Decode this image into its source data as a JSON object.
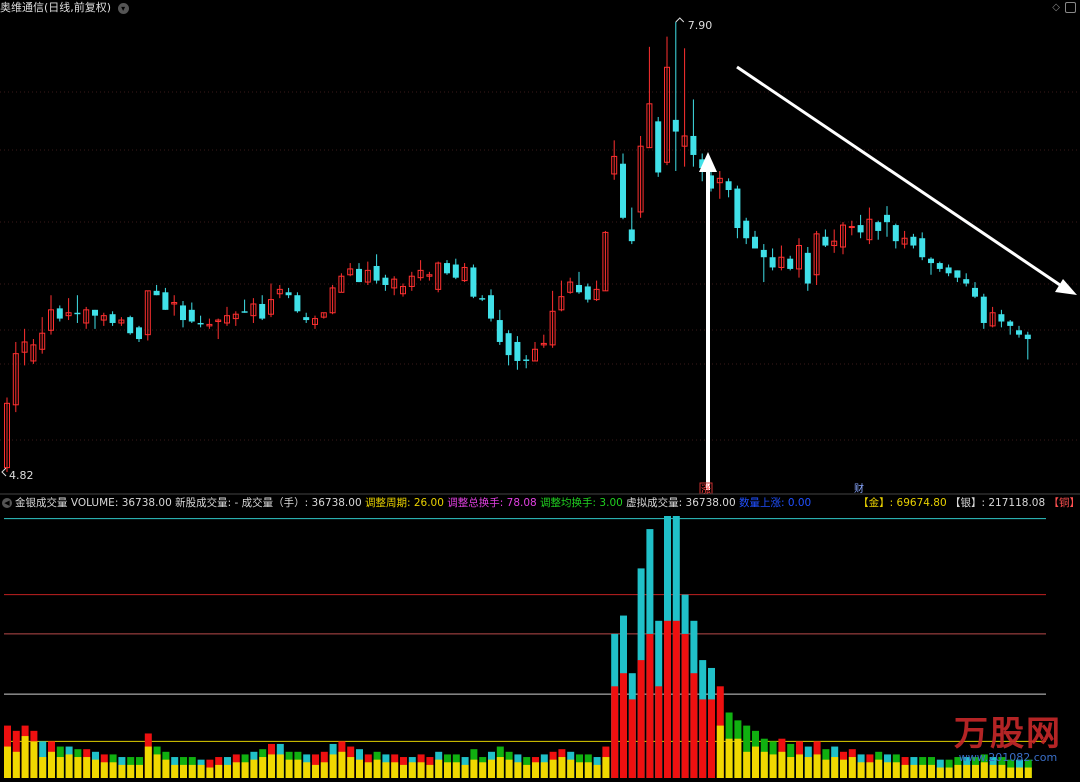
{
  "title": {
    "stock_name": "奥维通信",
    "mode": "(日线,前复权)"
  },
  "price_labels": {
    "high": "7.90",
    "low": "4.82"
  },
  "markers": {
    "zhang": "涨",
    "cai": "财"
  },
  "indicator": {
    "caret": "◀",
    "name": "金银成交量",
    "volume": "VOLUME: 36738.00",
    "new_stock": "新股成交量: -",
    "vol_hand": "成交量（手）: 36738.00",
    "adj_period": "调整周期: 26.00",
    "adj_total_turnover": "调整总换手: 78.08",
    "adj_avg_turnover": "调整均换手: 3.00",
    "virtual_vol": "虚拟成交量: 36738.00",
    "vol_up": "数量上涨: 0.00",
    "gold": "【金】: 69674.80",
    "silver": "【银】: 217118.08",
    "copper": "【铜】"
  },
  "watermark": {
    "logo": "万股网",
    "url": "www.201082.com"
  },
  "colors": {
    "up": "#ff3030",
    "down": "#40e0e8",
    "vol_red": "#ee1010",
    "vol_cyan": "#20c0c8",
    "vol_green": "#10b010",
    "vol_yellow": "#f0d800",
    "arrow": "#ffffff"
  },
  "chart_data": {
    "type": "candlestick",
    "ylim": [
      4.82,
      7.9
    ],
    "candles": [
      [
        4.85,
        5.29,
        5.33,
        4.82
      ],
      [
        5.28,
        5.63,
        5.71,
        5.23
      ],
      [
        5.64,
        5.71,
        5.8,
        5.55
      ],
      [
        5.58,
        5.69,
        5.73,
        5.56
      ],
      [
        5.66,
        5.77,
        5.88,
        5.63
      ],
      [
        5.79,
        5.93,
        6.03,
        5.76
      ],
      [
        5.94,
        5.87,
        5.96,
        5.85
      ],
      [
        5.89,
        5.91,
        6.01,
        5.86
      ],
      [
        5.91,
        5.9,
        6.03,
        5.84
      ],
      [
        5.84,
        5.93,
        5.95,
        5.8
      ],
      [
        5.93,
        5.89,
        5.93,
        5.8
      ],
      [
        5.86,
        5.89,
        5.91,
        5.82
      ],
      [
        5.9,
        5.84,
        5.92,
        5.82
      ],
      [
        5.84,
        5.86,
        5.88,
        5.82
      ],
      [
        5.88,
        5.77,
        5.89,
        5.76
      ],
      [
        5.81,
        5.73,
        5.82,
        5.71
      ],
      [
        5.76,
        6.06,
        6.06,
        5.72
      ],
      [
        6.06,
        6.03,
        6.1,
        6.03
      ],
      [
        6.05,
        5.93,
        6.08,
        5.93
      ],
      [
        5.97,
        5.98,
        6.03,
        5.89
      ],
      [
        5.96,
        5.86,
        5.99,
        5.81
      ],
      [
        5.93,
        5.85,
        5.98,
        5.84
      ],
      [
        5.84,
        5.83,
        5.89,
        5.81
      ],
      [
        5.82,
        5.83,
        5.87,
        5.8
      ],
      [
        5.85,
        5.86,
        5.87,
        5.73
      ],
      [
        5.84,
        5.89,
        5.95,
        5.82
      ],
      [
        5.87,
        5.9,
        5.92,
        5.82
      ],
      [
        5.92,
        5.91,
        6.0,
        5.91
      ],
      [
        5.89,
        5.97,
        6.01,
        5.84
      ],
      [
        5.97,
        5.87,
        6.03,
        5.86
      ],
      [
        5.9,
        6.0,
        6.11,
        5.88
      ],
      [
        6.04,
        6.07,
        6.1,
        6.01
      ],
      [
        6.05,
        6.03,
        6.08,
        6.01
      ],
      [
        6.03,
        5.92,
        6.05,
        5.91
      ],
      [
        5.88,
        5.86,
        5.91,
        5.84
      ],
      [
        5.83,
        5.87,
        5.89,
        5.8
      ],
      [
        5.88,
        5.91,
        5.91,
        5.87
      ],
      [
        5.91,
        6.08,
        6.1,
        5.9
      ],
      [
        6.05,
        6.16,
        6.18,
        6.05
      ],
      [
        6.17,
        6.21,
        6.25,
        6.16
      ],
      [
        6.21,
        6.12,
        6.25,
        6.12
      ],
      [
        6.12,
        6.2,
        6.26,
        6.1
      ],
      [
        6.23,
        6.13,
        6.31,
        6.11
      ],
      [
        6.15,
        6.1,
        6.17,
        6.06
      ],
      [
        6.08,
        6.14,
        6.16,
        6.03
      ],
      [
        6.04,
        6.09,
        6.11,
        6.02
      ],
      [
        6.09,
        6.16,
        6.19,
        6.06
      ],
      [
        6.15,
        6.2,
        6.27,
        6.13
      ],
      [
        6.16,
        6.17,
        6.19,
        6.13
      ],
      [
        6.07,
        6.25,
        6.26,
        6.05
      ],
      [
        6.25,
        6.18,
        6.27,
        6.17
      ],
      [
        6.24,
        6.15,
        6.28,
        6.14
      ],
      [
        6.13,
        6.22,
        6.25,
        6.12
      ],
      [
        6.22,
        6.02,
        6.24,
        6.01
      ],
      [
        6.01,
        6.0,
        6.03,
        5.99
      ],
      [
        6.03,
        5.87,
        6.07,
        5.85
      ],
      [
        5.86,
        5.71,
        5.93,
        5.69
      ],
      [
        5.77,
        5.62,
        5.79,
        5.55
      ],
      [
        5.71,
        5.58,
        5.75,
        5.52
      ],
      [
        5.59,
        5.58,
        5.62,
        5.53
      ],
      [
        5.58,
        5.66,
        5.71,
        5.58
      ],
      [
        5.69,
        5.7,
        5.76,
        5.67
      ],
      [
        5.69,
        5.92,
        6.06,
        5.67
      ],
      [
        5.93,
        6.02,
        6.13,
        5.92
      ],
      [
        6.05,
        6.12,
        6.15,
        6.04
      ],
      [
        6.1,
        6.05,
        6.19,
        6.04
      ],
      [
        6.09,
        6.0,
        6.11,
        5.98
      ],
      [
        6.0,
        6.07,
        6.13,
        5.99
      ],
      [
        6.06,
        6.46,
        6.47,
        6.06
      ],
      [
        6.86,
        6.98,
        7.09,
        6.82
      ],
      [
        6.93,
        6.56,
        7.0,
        6.55
      ],
      [
        6.48,
        6.4,
        6.63,
        6.38
      ],
      [
        6.6,
        7.05,
        7.12,
        6.56
      ],
      [
        7.04,
        7.34,
        7.73,
        7.04
      ],
      [
        7.22,
        6.87,
        7.25,
        6.84
      ],
      [
        6.94,
        7.59,
        7.8,
        6.92
      ],
      [
        7.23,
        7.15,
        7.9,
        6.88
      ],
      [
        7.05,
        7.12,
        7.72,
        6.91
      ],
      [
        7.12,
        6.99,
        7.37,
        6.91
      ],
      [
        6.96,
        6.9,
        7.0,
        6.81
      ],
      [
        6.85,
        6.76,
        6.89,
        6.74
      ],
      [
        6.8,
        6.83,
        6.88,
        6.69
      ],
      [
        6.81,
        6.75,
        6.83,
        6.7
      ],
      [
        6.76,
        6.49,
        6.78,
        6.42
      ],
      [
        6.54,
        6.42,
        6.56,
        6.38
      ],
      [
        6.43,
        6.35,
        6.47,
        6.35
      ],
      [
        6.34,
        6.29,
        6.38,
        6.12
      ],
      [
        6.29,
        6.22,
        6.35,
        6.2
      ],
      [
        6.22,
        6.29,
        6.37,
        6.2
      ],
      [
        6.28,
        6.21,
        6.3,
        6.2
      ],
      [
        6.21,
        6.37,
        6.42,
        6.15
      ],
      [
        6.32,
        6.11,
        6.36,
        6.06
      ],
      [
        6.17,
        6.45,
        6.47,
        6.1
      ],
      [
        6.43,
        6.37,
        6.48,
        6.36
      ],
      [
        6.37,
        6.4,
        6.48,
        6.32
      ],
      [
        6.36,
        6.51,
        6.53,
        6.31
      ],
      [
        6.5,
        6.5,
        6.54,
        6.44
      ],
      [
        6.51,
        6.46,
        6.58,
        6.42
      ],
      [
        6.41,
        6.55,
        6.63,
        6.38
      ],
      [
        6.53,
        6.47,
        6.54,
        6.41
      ],
      [
        6.58,
        6.53,
        6.64,
        6.43
      ],
      [
        6.51,
        6.4,
        6.52,
        6.35
      ],
      [
        6.38,
        6.42,
        6.47,
        6.35
      ],
      [
        6.43,
        6.37,
        6.45,
        6.35
      ],
      [
        6.42,
        6.29,
        6.46,
        6.27
      ],
      [
        6.28,
        6.25,
        6.29,
        6.17
      ],
      [
        6.25,
        6.21,
        6.26,
        6.19
      ],
      [
        6.22,
        6.18,
        6.24,
        6.16
      ],
      [
        6.2,
        6.15,
        6.2,
        6.12
      ],
      [
        6.14,
        6.11,
        6.18,
        6.09
      ],
      [
        6.08,
        6.02,
        6.12,
        6.01
      ],
      [
        6.02,
        5.84,
        6.04,
        5.8
      ],
      [
        5.82,
        5.91,
        5.95,
        5.81
      ],
      [
        5.9,
        5.85,
        5.93,
        5.81
      ],
      [
        5.85,
        5.82,
        5.86,
        5.76
      ],
      [
        5.79,
        5.76,
        5.82,
        5.74
      ],
      [
        5.76,
        5.73,
        5.78,
        5.59
      ]
    ],
    "volume_candles": [
      [
        0.12,
        0.2
      ],
      [
        0.1,
        0.18
      ],
      [
        0.16,
        0.2
      ],
      [
        0.14,
        0.18
      ],
      [
        0.08,
        0.14
      ],
      [
        0.1,
        0.14
      ],
      [
        0.08,
        0.12
      ],
      [
        0.09,
        0.12
      ],
      [
        0.08,
        0.11
      ],
      [
        0.08,
        0.11
      ],
      [
        0.07,
        0.1
      ],
      [
        0.06,
        0.09
      ],
      [
        0.06,
        0.09
      ],
      [
        0.05,
        0.08
      ],
      [
        0.05,
        0.08
      ],
      [
        0.05,
        0.08
      ],
      [
        0.12,
        0.17
      ],
      [
        0.09,
        0.12
      ],
      [
        0.07,
        0.1
      ],
      [
        0.05,
        0.08
      ],
      [
        0.05,
        0.08
      ],
      [
        0.05,
        0.08
      ],
      [
        0.05,
        0.07
      ],
      [
        0.04,
        0.07
      ],
      [
        0.05,
        0.08
      ],
      [
        0.05,
        0.08
      ],
      [
        0.06,
        0.09
      ],
      [
        0.06,
        0.09
      ],
      [
        0.07,
        0.1
      ],
      [
        0.08,
        0.11
      ],
      [
        0.09,
        0.13
      ],
      [
        0.09,
        0.13
      ],
      [
        0.07,
        0.1
      ],
      [
        0.07,
        0.1
      ],
      [
        0.06,
        0.09
      ],
      [
        0.05,
        0.09
      ],
      [
        0.06,
        0.1
      ],
      [
        0.09,
        0.13
      ],
      [
        0.1,
        0.14
      ],
      [
        0.08,
        0.12
      ],
      [
        0.07,
        0.11
      ],
      [
        0.06,
        0.09
      ],
      [
        0.07,
        0.1
      ],
      [
        0.06,
        0.09
      ],
      [
        0.06,
        0.09
      ],
      [
        0.05,
        0.08
      ],
      [
        0.06,
        0.08
      ],
      [
        0.06,
        0.09
      ],
      [
        0.05,
        0.08
      ],
      [
        0.07,
        0.1
      ],
      [
        0.06,
        0.09
      ],
      [
        0.06,
        0.09
      ],
      [
        0.05,
        0.08
      ],
      [
        0.07,
        0.11
      ],
      [
        0.06,
        0.08
      ],
      [
        0.07,
        0.1
      ],
      [
        0.08,
        0.12
      ],
      [
        0.07,
        0.1
      ],
      [
        0.06,
        0.09
      ],
      [
        0.05,
        0.08
      ],
      [
        0.06,
        0.08
      ],
      [
        0.06,
        0.09
      ],
      [
        0.07,
        0.1
      ],
      [
        0.08,
        0.11
      ],
      [
        0.07,
        0.1
      ],
      [
        0.06,
        0.09
      ],
      [
        0.06,
        0.09
      ],
      [
        0.05,
        0.08
      ],
      [
        0.08,
        0.12
      ],
      [
        0.35,
        0.55
      ],
      [
        0.4,
        0.62
      ],
      [
        0.3,
        0.4
      ],
      [
        0.45,
        0.8
      ],
      [
        0.55,
        0.95
      ],
      [
        0.35,
        0.6
      ],
      [
        0.6,
        1.0
      ],
      [
        0.6,
        1.0
      ],
      [
        0.55,
        0.7
      ],
      [
        0.4,
        0.6
      ],
      [
        0.3,
        0.45
      ],
      [
        0.3,
        0.42
      ],
      [
        0.2,
        0.35
      ],
      [
        0.15,
        0.25
      ],
      [
        0.15,
        0.22
      ],
      [
        0.1,
        0.2
      ],
      [
        0.12,
        0.18
      ],
      [
        0.1,
        0.15
      ],
      [
        0.09,
        0.14
      ],
      [
        0.1,
        0.15
      ],
      [
        0.08,
        0.13
      ],
      [
        0.09,
        0.14
      ],
      [
        0.08,
        0.12
      ],
      [
        0.09,
        0.14
      ],
      [
        0.07,
        0.11
      ],
      [
        0.08,
        0.12
      ],
      [
        0.07,
        0.1
      ],
      [
        0.08,
        0.11
      ],
      [
        0.06,
        0.09
      ],
      [
        0.06,
        0.09
      ],
      [
        0.07,
        0.1
      ],
      [
        0.06,
        0.09
      ],
      [
        0.06,
        0.09
      ],
      [
        0.05,
        0.08
      ],
      [
        0.05,
        0.08
      ],
      [
        0.05,
        0.08
      ],
      [
        0.05,
        0.08
      ],
      [
        0.04,
        0.07
      ],
      [
        0.04,
        0.07
      ],
      [
        0.05,
        0.08
      ],
      [
        0.05,
        0.08
      ],
      [
        0.05,
        0.08
      ],
      [
        0.06,
        0.09
      ],
      [
        0.05,
        0.08
      ],
      [
        0.05,
        0.08
      ],
      [
        0.04,
        0.07
      ],
      [
        0.04,
        0.07
      ],
      [
        0.04,
        0.07
      ]
    ],
    "volume_ref_levels": [
      0.14,
      0.32,
      0.55,
      0.7,
      0.99
    ]
  }
}
